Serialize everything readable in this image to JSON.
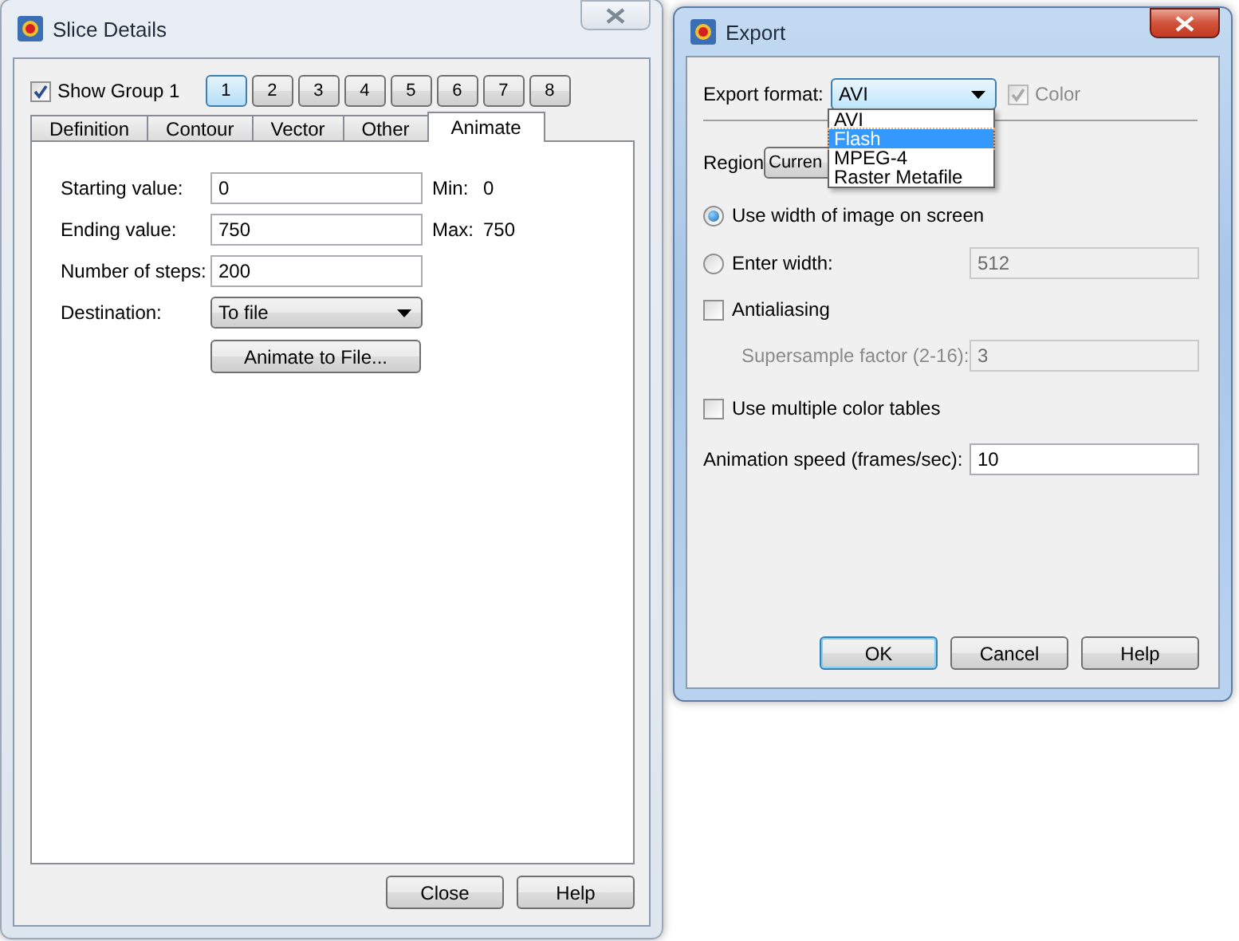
{
  "slice_details": {
    "title": "Slice Details",
    "active": false,
    "show_group": {
      "label": "Show Group 1",
      "checked": true
    },
    "group_buttons": [
      {
        "label": "1",
        "selected": true
      },
      {
        "label": "2",
        "selected": false
      },
      {
        "label": "3",
        "selected": false
      },
      {
        "label": "4",
        "selected": false
      },
      {
        "label": "5",
        "selected": false
      },
      {
        "label": "6",
        "selected": false
      },
      {
        "label": "7",
        "selected": false
      },
      {
        "label": "8",
        "selected": false
      }
    ],
    "tabs": [
      {
        "label": "Definition",
        "selected": false
      },
      {
        "label": "Contour",
        "selected": false
      },
      {
        "label": "Vector",
        "selected": false
      },
      {
        "label": "Other",
        "selected": false
      },
      {
        "label": "Animate",
        "selected": true
      }
    ],
    "fields": [
      {
        "label": "Starting value:",
        "value": "0",
        "range_label": "Min:",
        "range_value": "0"
      },
      {
        "label": "Ending value:",
        "value": "750",
        "range_label": "Max:",
        "range_value": "750"
      },
      {
        "label": "Number of steps:",
        "value": "200"
      }
    ],
    "destination": {
      "label": "Destination:",
      "value": "To file"
    },
    "animate_button": "Animate to File...",
    "buttons": [
      {
        "label": "Close",
        "default": false
      },
      {
        "label": "Help",
        "default": false
      }
    ]
  },
  "export": {
    "title": "Export",
    "active": true,
    "format": {
      "label": "Export format:",
      "value": "AVI",
      "expanded": true,
      "options": [
        {
          "label": "AVI",
          "highlighted": false
        },
        {
          "label": "Flash",
          "highlighted": true
        },
        {
          "label": "MPEG-4",
          "highlighted": false
        },
        {
          "label": "Raster Metafile",
          "highlighted": false
        }
      ]
    },
    "color": {
      "label": "Color",
      "checked": true,
      "disabled": true
    },
    "region": {
      "label": "Region",
      "value": "Curren"
    },
    "width_options": [
      {
        "label": "Use width of image on screen",
        "selected": true
      },
      {
        "label": "Enter width:",
        "selected": false,
        "value": "512",
        "disabled": true
      }
    ],
    "antialiasing": {
      "label": "Antialiasing",
      "checked": false
    },
    "supersample": {
      "label": "Supersample factor (2-16):",
      "value": "3",
      "disabled": true
    },
    "multiple_color_tables": {
      "label": "Use multiple color tables",
      "checked": false
    },
    "animation_speed": {
      "label": "Animation speed (frames/sec):",
      "value": "10"
    },
    "buttons": [
      {
        "label": "OK",
        "default": true
      },
      {
        "label": "Cancel",
        "default": false
      },
      {
        "label": "Help",
        "default": false
      }
    ]
  }
}
